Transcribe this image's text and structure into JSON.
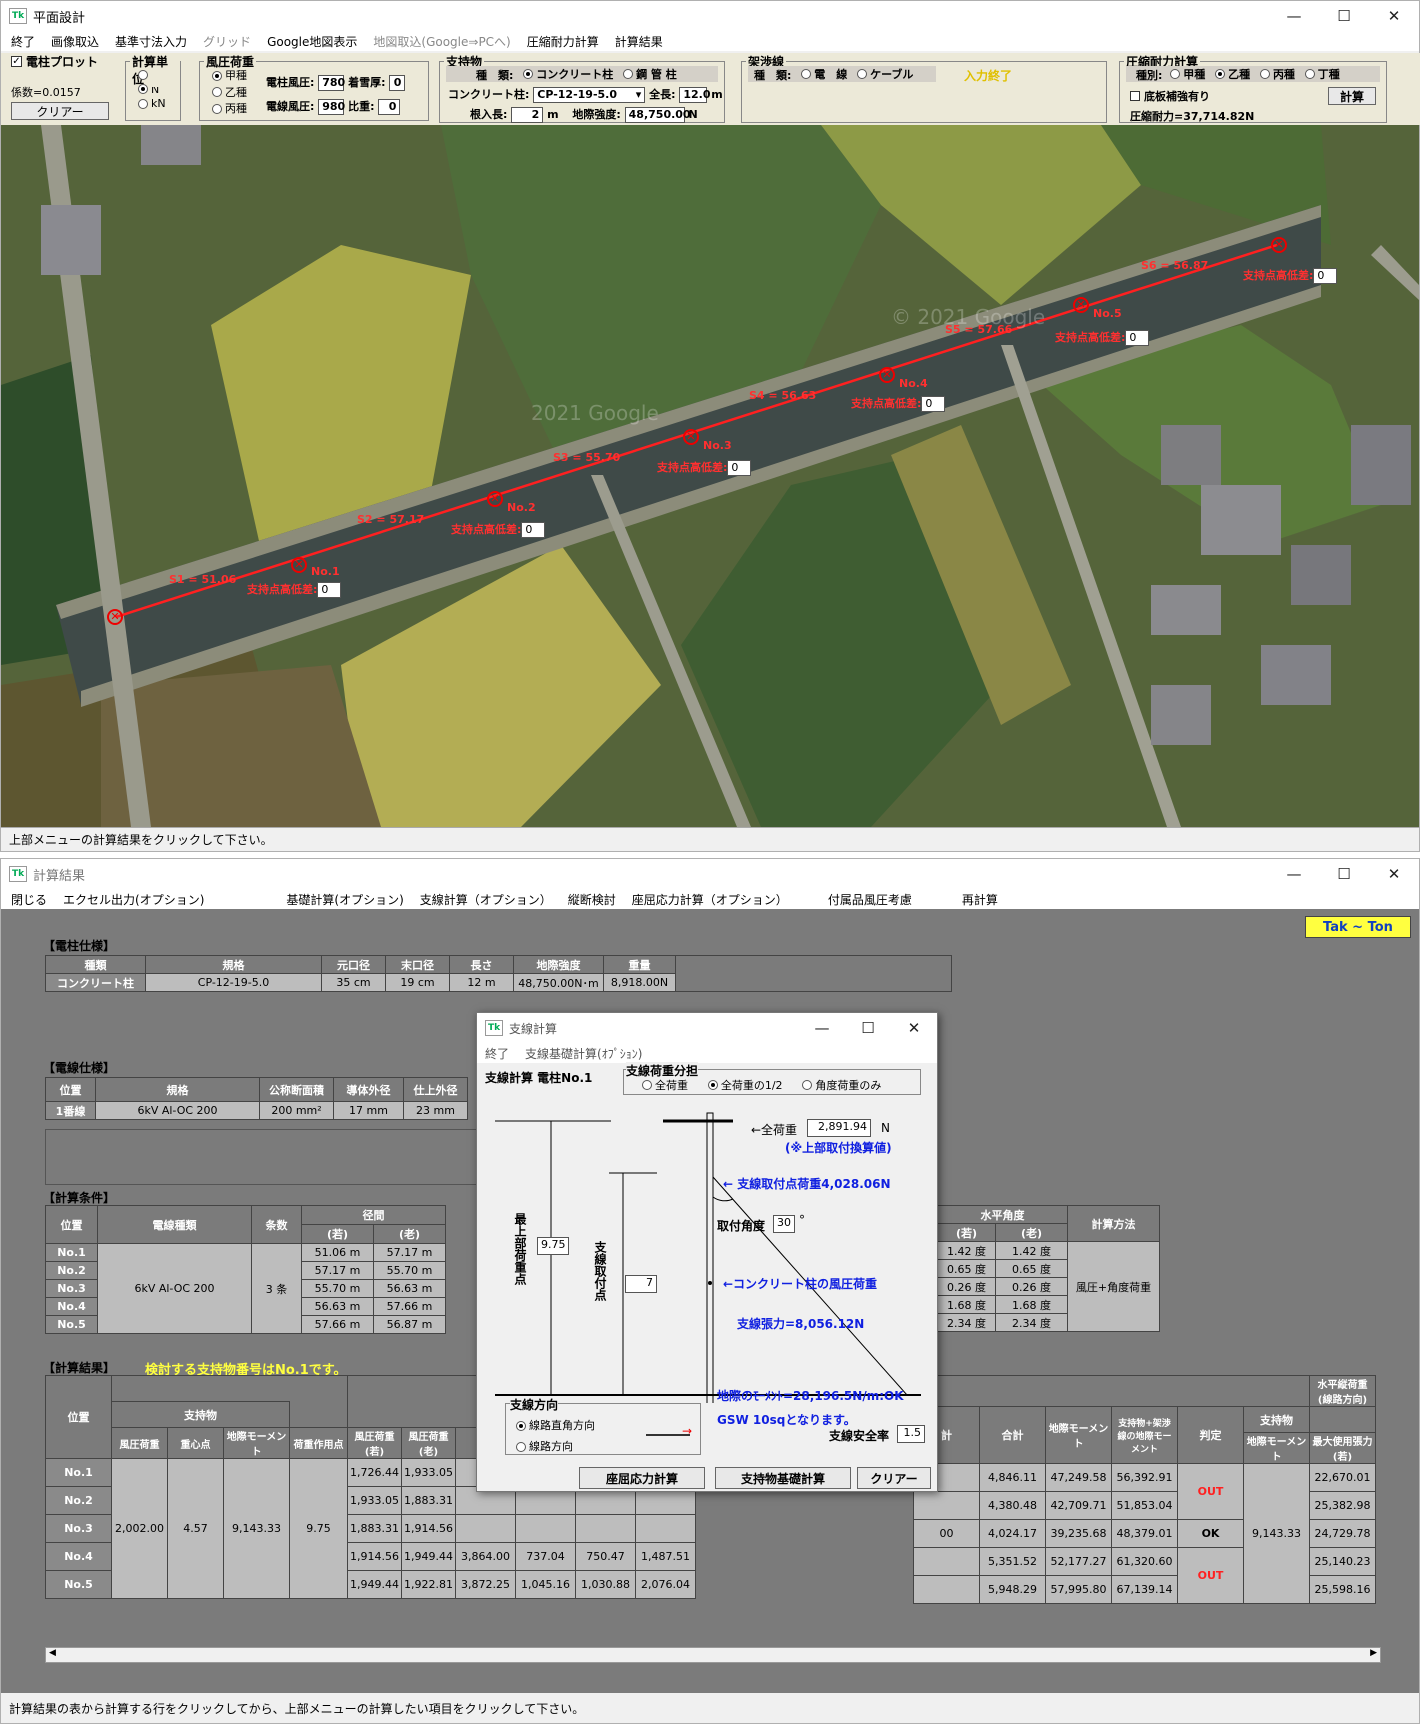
{
  "plan_window": {
    "title": "平面設計",
    "menu": [
      "終了",
      "画像取込",
      "基準寸法入力",
      "グリッド",
      "Google地図表示",
      "地図取込(Google⇒PCへ)",
      "圧縮耐力計算",
      "計算結果"
    ],
    "plot_checkbox": "電柱プロット",
    "coef": "係数=0.0157",
    "clear_btn": "クリアー",
    "unit_group": {
      "label": "計算単位",
      "options": [
        "kg",
        "N",
        "kN"
      ],
      "selected": "N"
    },
    "wind_group": {
      "label": "風圧荷重",
      "options": [
        "甲種",
        "乙種",
        "丙種"
      ],
      "selected": "甲種",
      "pole_wind_label": "電柱風圧:",
      "pole_wind": "780",
      "snow_label": "着雪厚:",
      "snow": "0",
      "wire_wind_label": "電線風圧:",
      "wire_wind": "980",
      "ratio_label": "比重:",
      "ratio": "0"
    },
    "support_group": {
      "label": "支持物",
      "type_label": "種　類:",
      "types": [
        "コンクリート柱",
        "鋼 管 柱"
      ],
      "type_selected": "コンクリート柱",
      "pole_label": "コンクリート柱:",
      "pole_value": "CP-12-19-5.0",
      "length_label": "全長:",
      "length": "12.0",
      "length_unit": "m",
      "embed_label": "根入長:",
      "embed": "2",
      "embed_unit": "m",
      "strength_label": "地際強度:",
      "strength": "48,750.00",
      "strength_unit": "N"
    },
    "wire_group": {
      "label": "架渉線",
      "type_label": "種　類:",
      "types": [
        "電　線",
        "ケーブル"
      ],
      "selected": "",
      "status": "入力終了"
    },
    "comp_group": {
      "label": "圧縮耐力計算",
      "type_label": "種別:",
      "types": [
        "甲種",
        "乙種",
        "丙種",
        "丁種"
      ],
      "selected": "乙種",
      "reinforce": "底板補強有り",
      "result": "圧縮耐力=37,714.82N",
      "calc_btn": "計算"
    },
    "map_labels": {
      "spans": [
        "S1 = 51.06",
        "S2 = 57.17",
        "S3 = 55.70",
        "S4 = 56.63",
        "S5 = 57.66",
        "S6 = 56.87"
      ],
      "poles": [
        "No.1",
        "No.2",
        "No.3",
        "No.4",
        "No.5"
      ],
      "diff_label": "支持点高低差:",
      "diff_value": "0",
      "watermark1": "© 2021 Google",
      "watermark2": "2021 Google"
    },
    "status": "上部メニューの計算結果をクリックして下さい。"
  },
  "result_window": {
    "title": "計算結果",
    "menu": [
      "閉じる",
      "エクセル出力(オプション)",
      "基礎計算(オプション)",
      "支線計算（オプション）",
      "縦断検討",
      "座屈応力計算（オプション）",
      "付属品風圧考慮",
      "再計算"
    ],
    "logo": "Tak ~ Ton",
    "pole_spec": {
      "title": "【電柱仕様】",
      "headers": [
        "種類",
        "規格",
        "元口径",
        "末口径",
        "長さ",
        "地際強度",
        "重量"
      ],
      "row": [
        "コンクリート柱",
        "CP-12-19-5.0",
        "35 cm",
        "19 cm",
        "12 m",
        "48,750.00N･m",
        "8,918.00N"
      ]
    },
    "wire_spec": {
      "title": "【電線仕様】",
      "headers": [
        "位置",
        "規格",
        "公称断面積",
        "導体外径",
        "仕上外径"
      ],
      "row": [
        "1番線",
        "6kV Al-OC 200",
        "200 mm²",
        "17 mm",
        "23 mm"
      ]
    },
    "conditions": {
      "title": "【計算条件】",
      "headers": [
        "位置",
        "電線種類",
        "条数",
        "径間",
        "水平角度",
        "計算方法"
      ],
      "sub": [
        "(若)",
        "(老)"
      ],
      "positions": [
        "No.1",
        "No.2",
        "No.3",
        "No.4",
        "No.5"
      ],
      "wire_type": "6kV Al-OC 200",
      "count": "3 条",
      "method": "風圧+角度荷重",
      "span_young": [
        "51.06 m",
        "57.17 m",
        "55.70 m",
        "56.63 m",
        "57.66 m"
      ],
      "span_old": [
        "57.17 m",
        "55.70 m",
        "56.63 m",
        "57.66 m",
        "56.87 m"
      ],
      "angle_young": [
        "1.42 度",
        "0.65 度",
        "0.26 度",
        "1.68 度",
        "2.34 度"
      ],
      "angle_old": [
        "1.42 度",
        "0.65 度",
        "0.26 度",
        "1.68 度",
        "2.34 度"
      ]
    },
    "results": {
      "title": "【計算結果】",
      "notice": "検討する支持物番号はNo.1です。",
      "headers": {
        "pos": "位置",
        "support": "支持物",
        "wind": "風圧荷重",
        "center": "重心点",
        "moment": "地際モーメント",
        "act": "荷重作用点",
        "wy": "風圧荷重(若)",
        "wo": "風圧荷重(老)",
        "calc": "計",
        "total": "合計",
        "gm": "地際モーメント",
        "sum": "支持物+架渉線の地際モーメント",
        "judge": "判定",
        "horiz": "水平縦荷重(線路方向)",
        "h_support": "支持物",
        "h_moment": "地際モーメント",
        "h_max": "最大使用張力(若)"
      },
      "support_vals": {
        "wind": "2,002.00",
        "center": "4.57",
        "moment": "9,143.33",
        "act": "9.75"
      },
      "positions": [
        "No.1",
        "No.2",
        "No.3",
        "No.4",
        "No.5"
      ],
      "wy": [
        "1,726.44",
        "1,933.05",
        "1,883.31",
        "1,914.56",
        "1,949.44"
      ],
      "wo": [
        "1,933.05",
        "1,883.31",
        "1,914.56",
        "1,949.44",
        "1,922.81"
      ],
      "extra": [
        [
          "",
          "",
          "",
          "",
          ""
        ],
        [
          "",
          "",
          "",
          "",
          ""
        ],
        [
          "",
          "",
          "",
          "",
          ""
        ],
        [
          "3,864.00",
          "737.04",
          "750.47",
          "1,487.51"
        ],
        [
          "3,872.25",
          "1,045.16",
          "1,030.88",
          "2,076.04"
        ]
      ],
      "calc_col": [
        "",
        "",
        "00",
        "",
        ""
      ],
      "total": [
        "4,846.11",
        "4,380.48",
        "4,024.17",
        "5,351.52",
        "5,948.29"
      ],
      "gm": [
        "47,249.58",
        "42,709.71",
        "39,235.68",
        "52,177.27",
        "57,995.80"
      ],
      "sum": [
        "56,392.91",
        "51,853.04",
        "48,379.01",
        "61,320.60",
        "67,139.14"
      ],
      "judge_a": "OUT",
      "judge_b": "OK",
      "judge_c": "OUT",
      "h_moment": "9,143.33",
      "h_max": [
        "22,670.01",
        "25,382.98",
        "24,729.78",
        "25,140.23",
        "25,598.16"
      ]
    },
    "status": "計算結果の表から計算する行をクリックしてから、上部メニューの計算したい項目をクリックして下さい。"
  },
  "dialog": {
    "title": "支線計算",
    "menu": [
      "終了",
      "支線基礎計算(ｵﾌﾟｼｮﾝ)"
    ],
    "heading": "支線計算 電柱No.1",
    "load_group": {
      "label": "支線荷重分担",
      "options": [
        "全荷重",
        "全荷重の1/2",
        "角度荷重のみ"
      ],
      "selected": "全荷重の1/2"
    },
    "total_load_label": "←全荷重",
    "total_load": "2,891.94",
    "total_load_unit": "N",
    "note": "(※上部取付換算値)",
    "attach_load": "← 支線取付点荷重4,028.06N",
    "angle_label": "取付角度",
    "angle": "30",
    "angle_unit": "°",
    "top_point_label": "最上部荷重点",
    "top_point": "9.75",
    "attach_point_label": "支線取付点",
    "attach_point": "7",
    "wind_label": "←コンクリート柱の風圧荷重",
    "tension": "支線張力=8,056.12N",
    "moment": "地際のﾓｰﾒﾝﾄ=28,196.5N/m:OK",
    "gsw": "GSW 10sqとなります。",
    "safety_label": "支線安全率",
    "safety": "1.5",
    "dir_group": {
      "label": "支線方向",
      "options": [
        "線路直角方向",
        "線路方向"
      ],
      "selected": "線路直角方向"
    },
    "buttons": [
      "座屈応力計算",
      "支持物基礎計算",
      "クリアー"
    ]
  }
}
